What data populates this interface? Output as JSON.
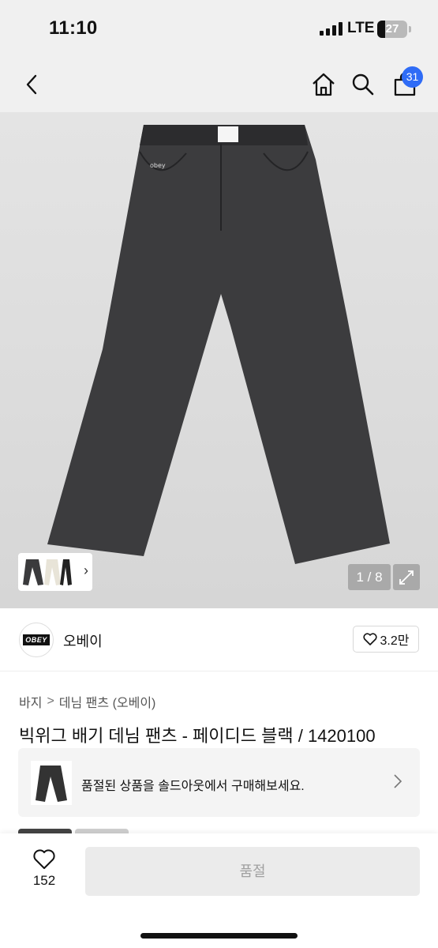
{
  "status": {
    "time": "11:10",
    "network": "LTE",
    "battery": "27",
    "battery_level": 0.27
  },
  "nav": {
    "cart_count": "31"
  },
  "gallery": {
    "counter": "1 / 8",
    "jeans_color": "#3c3c3e",
    "jeans_tag": "obey"
  },
  "brand": {
    "logo_text": "OBEY",
    "name": "오베이",
    "likes": "3.2만"
  },
  "breadcrumb": {
    "category": "바지",
    "separator": ">",
    "subcategory": "데님 팬츠 (오베이)"
  },
  "product": {
    "title": "빅위그 배기 데님 팬츠 - 페이디드 블랙 / 1420100"
  },
  "soldout_banner": {
    "text": "품절된 상품을 솔드아웃에서 구매해보세요."
  },
  "bottom": {
    "wish_count": "152",
    "soldout_label": "품절"
  },
  "colors": {
    "accent": "#2f6cf6",
    "nav_bg": "#f0f0f0",
    "disabled_bg": "#ebebeb",
    "disabled_text": "#a0a0a0"
  }
}
